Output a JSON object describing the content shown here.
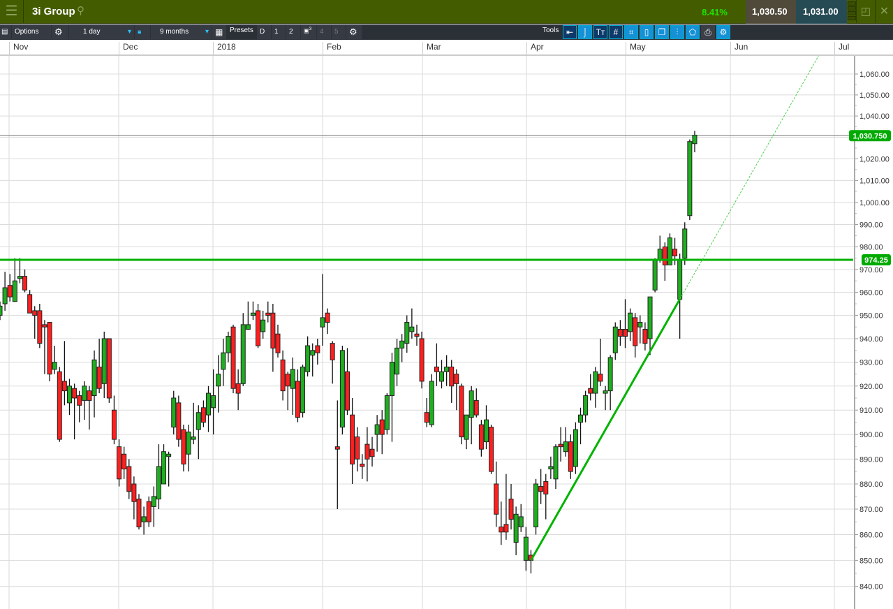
{
  "header": {
    "menu_icon": "hamburger-icon",
    "title": "3i Group",
    "search_icon": "search-icon",
    "change_pct": "8.41%",
    "sell_price": "1,030.50",
    "buy_price": "1,031.00",
    "sell_arrow": "⤵",
    "buy_arrow": "⤴"
  },
  "toolbar": {
    "options": "Options",
    "interval": "1 day",
    "period": "9 months",
    "presets": "Presets",
    "preset_buttons": [
      "D",
      "1",
      "2",
      "3",
      "4",
      "5"
    ],
    "tools": "Tools"
  },
  "colors": {
    "up": "#1fae1f",
    "down": "#ff1f1f",
    "hline": "#00b000",
    "trend": "#00b400",
    "header": "#445c00"
  },
  "chart_data": {
    "type": "candlestick",
    "x_tick_labels": [
      "Nov",
      "Dec",
      "2018",
      "Feb",
      "Mar",
      "Apr",
      "May",
      "Jun",
      "Jul"
    ],
    "y_ticks": [
      840,
      850,
      860,
      870,
      880,
      890,
      900,
      910,
      920,
      930,
      940,
      950,
      960,
      970,
      980,
      990,
      1000,
      1010,
      1020,
      1030,
      1040,
      1050,
      1060
    ],
    "y_tick_labels": [
      "840.00",
      "850.00",
      "860.00",
      "870.00",
      "880.00",
      "890.00",
      "900.00",
      "910.00",
      "920.00",
      "930.00",
      "940.00",
      "950.00",
      "960.00",
      "970.00",
      "980.00",
      "990.00",
      "1,000.00",
      "1,010.00",
      "1,020.00",
      "1,030.00",
      "1,040.00",
      "1,050.00",
      "1,060.00"
    ],
    "ylim": [
      835,
      1080
    ],
    "current_price": 1030.75,
    "current_price_label": "1,030.750",
    "hline_value": 974.25,
    "hline_label": "974.25",
    "trendline": {
      "from": [
        107,
        850
      ],
      "to": [
        137,
        957
      ]
    },
    "ohlc": [
      [
        950,
        956,
        948,
        954
      ],
      [
        955,
        969,
        952,
        962
      ],
      [
        963,
        968,
        956,
        958
      ],
      [
        956,
        975,
        956,
        965
      ],
      [
        966,
        975,
        964,
        967
      ],
      [
        967,
        970,
        960,
        961
      ],
      [
        959,
        961,
        951,
        951
      ],
      [
        952,
        954,
        940,
        950
      ],
      [
        952,
        955,
        936,
        938
      ],
      [
        946,
        948,
        925,
        945
      ],
      [
        947,
        947,
        922,
        925
      ],
      [
        927,
        937,
        925,
        930
      ],
      [
        926,
        928,
        897,
        898
      ],
      [
        922,
        939,
        912,
        918
      ],
      [
        913,
        923,
        908,
        920
      ],
      [
        919,
        921,
        898,
        915
      ],
      [
        916,
        918,
        905,
        912
      ],
      [
        914,
        922,
        906,
        920
      ],
      [
        918,
        920,
        902,
        914
      ],
      [
        916,
        935,
        907,
        931
      ],
      [
        928,
        940,
        917,
        919
      ],
      [
        921,
        943,
        915,
        940
      ],
      [
        940,
        940,
        913,
        915
      ],
      [
        910,
        916,
        896,
        898
      ],
      [
        895,
        898,
        879,
        882
      ],
      [
        892,
        895,
        882,
        886
      ],
      [
        887,
        890,
        874,
        877
      ],
      [
        880,
        883,
        866,
        873
      ],
      [
        874,
        876,
        862,
        863
      ],
      [
        865,
        871,
        860,
        867
      ],
      [
        873,
        875,
        863,
        865
      ],
      [
        871,
        879,
        863,
        875
      ],
      [
        874,
        896,
        870,
        887
      ],
      [
        880,
        896,
        880,
        893
      ],
      [
        891,
        893,
        879,
        892
      ],
      [
        903,
        918,
        900,
        915
      ],
      [
        913,
        916,
        895,
        898
      ],
      [
        902,
        904,
        885,
        888
      ],
      [
        892,
        904,
        885,
        901
      ],
      [
        898,
        913,
        896,
        899
      ],
      [
        902,
        912,
        890,
        909
      ],
      [
        911,
        914,
        903,
        905
      ],
      [
        908,
        920,
        901,
        917
      ],
      [
        911,
        927,
        900,
        916
      ],
      [
        920,
        933,
        909,
        925
      ],
      [
        927,
        940,
        920,
        934
      ],
      [
        934,
        943,
        930,
        941
      ],
      [
        945,
        946,
        917,
        919
      ],
      [
        921,
        927,
        910,
        917
      ],
      [
        921,
        951,
        920,
        946
      ],
      [
        944,
        956,
        944,
        946
      ],
      [
        950,
        956,
        948,
        951
      ],
      [
        952,
        955,
        936,
        937
      ],
      [
        943,
        952,
        940,
        948
      ],
      [
        951,
        956,
        947,
        950
      ],
      [
        951,
        955,
        926,
        936
      ],
      [
        942,
        946,
        932,
        934
      ],
      [
        931,
        935,
        914,
        918
      ],
      [
        925,
        926,
        910,
        920
      ],
      [
        919,
        932,
        908,
        927
      ],
      [
        922,
        927,
        905,
        907
      ],
      [
        909,
        929,
        907,
        928
      ],
      [
        926,
        941,
        924,
        937
      ],
      [
        933,
        938,
        924,
        935
      ],
      [
        937,
        940,
        929,
        934
      ],
      [
        945,
        968,
        937,
        949
      ],
      [
        951,
        953,
        942,
        947
      ],
      [
        938,
        939,
        921,
        931
      ],
      [
        895,
        914,
        870,
        894
      ],
      [
        903,
        937,
        900,
        935
      ],
      [
        926,
        936,
        908,
        910
      ],
      [
        908,
        915,
        880,
        888
      ],
      [
        899,
        903,
        885,
        890
      ],
      [
        888,
        892,
        882,
        887
      ],
      [
        896,
        903,
        881,
        890
      ],
      [
        894,
        899,
        887,
        891
      ],
      [
        900,
        908,
        893,
        904
      ],
      [
        906,
        910,
        892,
        900
      ],
      [
        902,
        917,
        900,
        916
      ],
      [
        916,
        934,
        897,
        930
      ],
      [
        925,
        940,
        920,
        936
      ],
      [
        936,
        942,
        930,
        939
      ],
      [
        938,
        950,
        934,
        947
      ],
      [
        943,
        953,
        940,
        945
      ],
      [
        942,
        946,
        937,
        941
      ],
      [
        940,
        943,
        919,
        922
      ],
      [
        909,
        915,
        903,
        905
      ],
      [
        904,
        925,
        903,
        922
      ],
      [
        928,
        938,
        920,
        926
      ],
      [
        922,
        931,
        919,
        926
      ],
      [
        926,
        933,
        920,
        928
      ],
      [
        928,
        931,
        913,
        920
      ],
      [
        925,
        927,
        910,
        921
      ],
      [
        920,
        921,
        896,
        899
      ],
      [
        898,
        908,
        894,
        908
      ],
      [
        907,
        920,
        896,
        918
      ],
      [
        914,
        919,
        907,
        908
      ],
      [
        904,
        906,
        891,
        894
      ],
      [
        897,
        912,
        894,
        906
      ],
      [
        903,
        904,
        884,
        885
      ],
      [
        880,
        889,
        863,
        868
      ],
      [
        863,
        873,
        856,
        861
      ],
      [
        864,
        884,
        858,
        861
      ],
      [
        874,
        880,
        862,
        866
      ],
      [
        857,
        871,
        852,
        868
      ],
      [
        863,
        872,
        861,
        867
      ],
      [
        850,
        863,
        846,
        859
      ],
      [
        852,
        854,
        845,
        850
      ],
      [
        863,
        882,
        860,
        880
      ],
      [
        879,
        886,
        872,
        877
      ],
      [
        881,
        884,
        866,
        876
      ],
      [
        886,
        891,
        882,
        887
      ],
      [
        882,
        896,
        878,
        895
      ],
      [
        896,
        903,
        889,
        895
      ],
      [
        893,
        903,
        891,
        897
      ],
      [
        897,
        900,
        882,
        885
      ],
      [
        887,
        905,
        884,
        902
      ],
      [
        905,
        911,
        896,
        908
      ],
      [
        908,
        918,
        905,
        916
      ],
      [
        919,
        925,
        914,
        917
      ],
      [
        917,
        928,
        911,
        926
      ],
      [
        925,
        940,
        920,
        922
      ],
      [
        917,
        920,
        910,
        918
      ],
      [
        918,
        933,
        910,
        932
      ],
      [
        934,
        947,
        931,
        945
      ],
      [
        944,
        948,
        937,
        941
      ],
      [
        944,
        957,
        936,
        941
      ],
      [
        943,
        953,
        939,
        951
      ],
      [
        949,
        951,
        932,
        937
      ],
      [
        945,
        950,
        938,
        947
      ],
      [
        944,
        947,
        935,
        938
      ],
      [
        940,
        958,
        933,
        958
      ],
      [
        961,
        975,
        960,
        974
      ],
      [
        974,
        985,
        973,
        979
      ],
      [
        980,
        982,
        965,
        972
      ],
      [
        972,
        986,
        972,
        984
      ],
      [
        979,
        984,
        972,
        976
      ],
      [
        957,
        977,
        940,
        974
      ],
      [
        975,
        991,
        972,
        988
      ],
      [
        994,
        1029,
        992,
        1028
      ],
      [
        1027,
        1033,
        1023,
        1031
      ]
    ]
  }
}
